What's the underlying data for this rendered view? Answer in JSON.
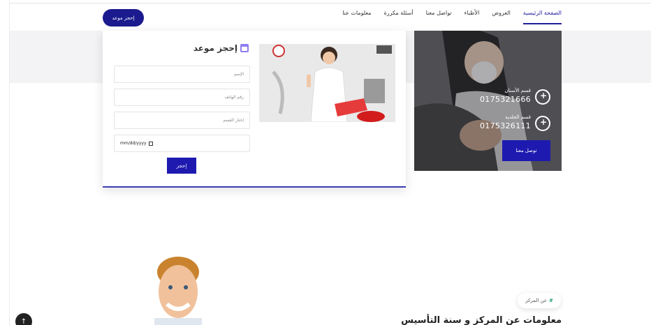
{
  "nav": {
    "items": [
      {
        "label": "الصفحة الرئيسية",
        "active": true
      },
      {
        "label": "العروض",
        "active": false
      },
      {
        "label": "الأطباء",
        "active": false
      },
      {
        "label": "تواصل معنا",
        "active": false
      },
      {
        "label": "أسئلة مكررة",
        "active": false
      },
      {
        "label": "معلومات عنا",
        "active": false
      }
    ],
    "book_button": "إحجز موعد"
  },
  "booking": {
    "title": "إحجز موعد",
    "name_placeholder": "الإسم",
    "phone_placeholder": "رقم الهاتف",
    "department_placeholder": "إختار القسم",
    "date_value": "mm/dd/yyyy",
    "submit": "إحجز"
  },
  "hero": {
    "departments": [
      {
        "name": "قسم الأسنان",
        "phone": "0175321666"
      },
      {
        "name": "قسم الجلدية",
        "phone": "0175326111"
      }
    ],
    "contact_button": "توصل معنا"
  },
  "about": {
    "badge_hash": "#",
    "badge": "عن المركز",
    "title": "معلومات عن المركز و سنة التأسيس"
  },
  "scroll_top": "↑",
  "colors": {
    "accent": "#1e1ab0",
    "nav_active": "#1f1f9e",
    "badge_hash": "#1aa06a"
  }
}
